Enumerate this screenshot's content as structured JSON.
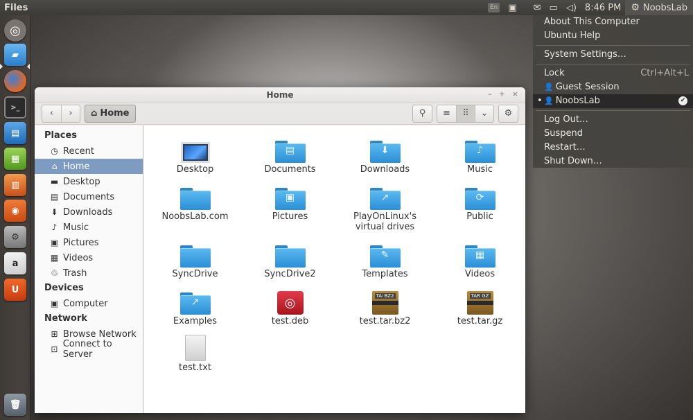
{
  "panel": {
    "app_name": "Files",
    "keyboard_layout": "En",
    "clock": "8:46 PM",
    "user_name": "NoobsLab"
  },
  "launcher": {
    "items": [
      {
        "name": "dash-home"
      },
      {
        "name": "files"
      },
      {
        "name": "firefox"
      },
      {
        "name": "terminal"
      },
      {
        "name": "libreoffice-writer"
      },
      {
        "name": "libreoffice-calc"
      },
      {
        "name": "libreoffice-impress"
      },
      {
        "name": "ubuntu-software-center"
      },
      {
        "name": "system-settings"
      },
      {
        "name": "amazon"
      },
      {
        "name": "ubuntu-one"
      },
      {
        "name": "trash"
      }
    ]
  },
  "window": {
    "title": "Home",
    "path_button": "Home",
    "sidebar": {
      "places_heading": "Places",
      "places": [
        {
          "label": "Recent",
          "icon": "clock-icon"
        },
        {
          "label": "Home",
          "icon": "home-icon",
          "selected": true
        },
        {
          "label": "Desktop",
          "icon": "desktop-icon"
        },
        {
          "label": "Documents",
          "icon": "document-icon"
        },
        {
          "label": "Downloads",
          "icon": "download-icon"
        },
        {
          "label": "Music",
          "icon": "music-icon"
        },
        {
          "label": "Pictures",
          "icon": "pictures-icon"
        },
        {
          "label": "Videos",
          "icon": "videos-icon"
        },
        {
          "label": "Trash",
          "icon": "trash-icon"
        }
      ],
      "devices_heading": "Devices",
      "devices": [
        {
          "label": "Computer",
          "icon": "computer-icon"
        }
      ],
      "network_heading": "Network",
      "network": [
        {
          "label": "Browse Network",
          "icon": "network-icon"
        },
        {
          "label": "Connect to Server",
          "icon": "server-icon"
        }
      ]
    },
    "files": [
      {
        "label": "Desktop",
        "kind": "desktop"
      },
      {
        "label": "Documents",
        "kind": "folder",
        "emblem": "▤"
      },
      {
        "label": "Downloads",
        "kind": "folder",
        "emblem": "⬇"
      },
      {
        "label": "Music",
        "kind": "folder",
        "emblem": "♪"
      },
      {
        "label": "NoobsLab.com",
        "kind": "folder",
        "emblem": ""
      },
      {
        "label": "Pictures",
        "kind": "folder",
        "emblem": "▣"
      },
      {
        "label": "PlayOnLinux's virtual drives",
        "kind": "folder",
        "emblem": "↗"
      },
      {
        "label": "Public",
        "kind": "folder",
        "emblem": "⟳"
      },
      {
        "label": "SyncDrive",
        "kind": "folder",
        "emblem": ""
      },
      {
        "label": "SyncDrive2",
        "kind": "folder",
        "emblem": ""
      },
      {
        "label": "Templates",
        "kind": "folder",
        "emblem": "✎"
      },
      {
        "label": "Videos",
        "kind": "folder",
        "emblem": "▦"
      },
      {
        "label": "Examples",
        "kind": "folder",
        "emblem": "↗"
      },
      {
        "label": "test.deb",
        "kind": "deb"
      },
      {
        "label": "test.tar.bz2",
        "kind": "archive",
        "tag1": "TAR",
        "tag2": "BZ2"
      },
      {
        "label": "test.tar.gz",
        "kind": "archive",
        "tag1": "TAR",
        "tag2": "GZ"
      },
      {
        "label": "test.txt",
        "kind": "text"
      }
    ]
  },
  "user_menu": {
    "about": "About This Computer",
    "help": "Ubuntu Help",
    "settings": "System Settings…",
    "lock": "Lock",
    "lock_shortcut": "Ctrl+Alt+L",
    "guest": "Guest Session",
    "current_user": "NoobsLab",
    "logout": "Log Out…",
    "suspend": "Suspend",
    "restart": "Restart…",
    "shutdown": "Shut Down…"
  }
}
